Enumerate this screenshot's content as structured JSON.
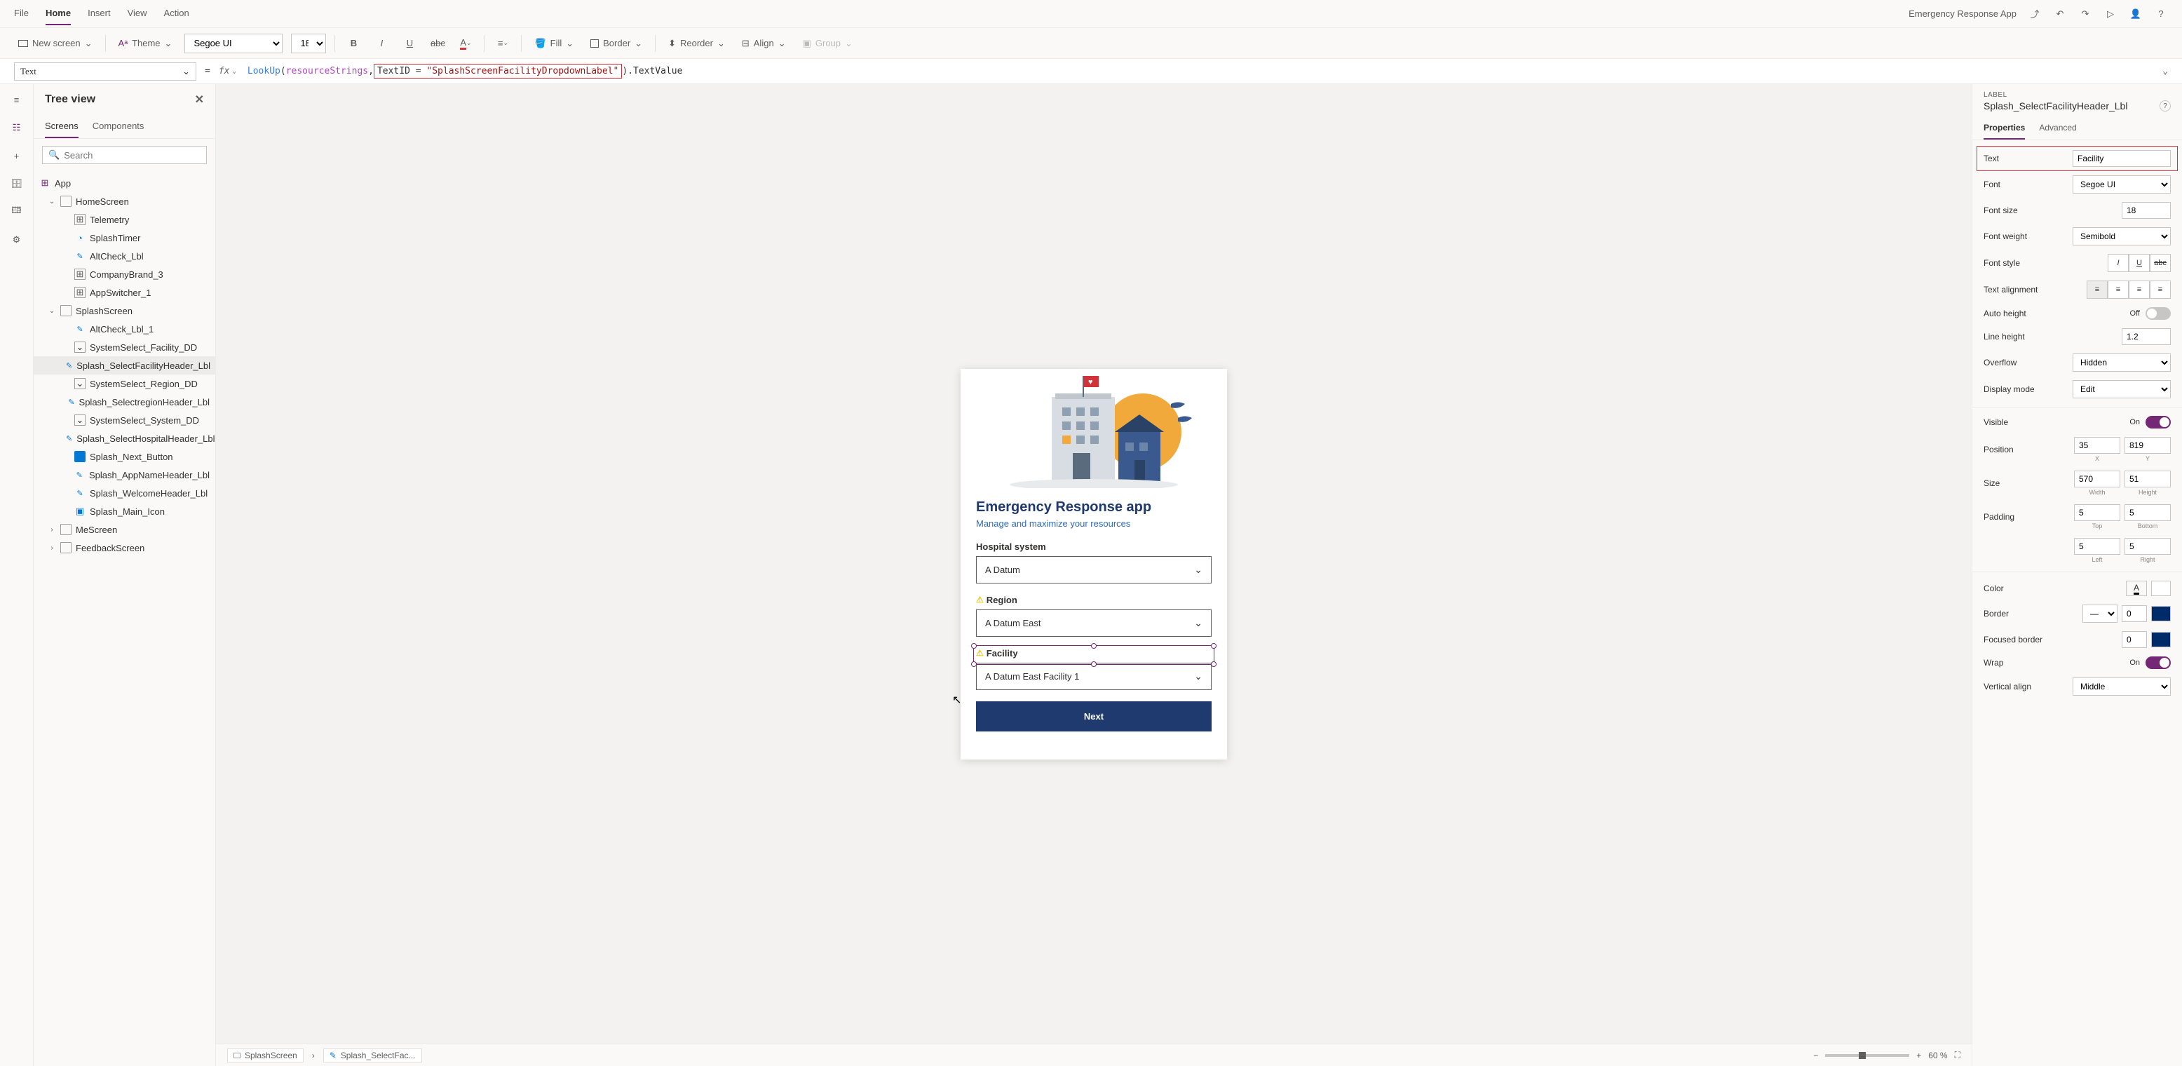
{
  "top": {
    "menus": [
      "File",
      "Home",
      "Insert",
      "View",
      "Action"
    ],
    "active": "Home",
    "appName": "Emergency Response App"
  },
  "ribbon": {
    "newScreen": "New screen",
    "theme": "Theme",
    "font": "Segoe UI",
    "size": "18",
    "fill": "Fill",
    "border": "Border",
    "reorder": "Reorder",
    "align": "Align",
    "group": "Group"
  },
  "formula": {
    "property": "Text",
    "fn": "LookUp",
    "arg1": "resourceStrings",
    "highlighted": "TextID = \"SplashScreenFacilityDropdownLabel\"",
    "suffix": ".TextValue"
  },
  "tree": {
    "title": "Tree view",
    "tabs": [
      "Screens",
      "Components"
    ],
    "activeTab": "Screens",
    "searchPlaceholder": "Search",
    "root": "App",
    "items": [
      {
        "name": "HomeScreen",
        "type": "screen",
        "indent": 1,
        "expanded": true
      },
      {
        "name": "Telemetry",
        "type": "group",
        "indent": 2
      },
      {
        "name": "SplashTimer",
        "type": "timer",
        "indent": 2
      },
      {
        "name": "AltCheck_Lbl",
        "type": "label",
        "indent": 2
      },
      {
        "name": "CompanyBrand_3",
        "type": "group",
        "indent": 2
      },
      {
        "name": "AppSwitcher_1",
        "type": "group",
        "indent": 2
      },
      {
        "name": "SplashScreen",
        "type": "screen",
        "indent": 1,
        "expanded": true
      },
      {
        "name": "AltCheck_Lbl_1",
        "type": "label",
        "indent": 2
      },
      {
        "name": "SystemSelect_Facility_DD",
        "type": "dropdown",
        "indent": 2
      },
      {
        "name": "Splash_SelectFacilityHeader_Lbl",
        "type": "label",
        "indent": 2,
        "selected": true
      },
      {
        "name": "SystemSelect_Region_DD",
        "type": "dropdown",
        "indent": 2
      },
      {
        "name": "Splash_SelectregionHeader_Lbl",
        "type": "label",
        "indent": 2
      },
      {
        "name": "SystemSelect_System_DD",
        "type": "dropdown",
        "indent": 2
      },
      {
        "name": "Splash_SelectHospitalHeader_Lbl",
        "type": "label",
        "indent": 2
      },
      {
        "name": "Splash_Next_Button",
        "type": "button",
        "indent": 2
      },
      {
        "name": "Splash_AppNameHeader_Lbl",
        "type": "label",
        "indent": 2
      },
      {
        "name": "Splash_WelcomeHeader_Lbl",
        "type": "label",
        "indent": 2
      },
      {
        "name": "Splash_Main_Icon",
        "type": "image",
        "indent": 2
      },
      {
        "name": "MeScreen",
        "type": "screen",
        "indent": 1,
        "expanded": false
      },
      {
        "name": "FeedbackScreen",
        "type": "screen",
        "indent": 1,
        "expanded": false
      }
    ]
  },
  "canvas": {
    "appTitle": "Emergency Response app",
    "appSubtitle": "Manage and maximize your resources",
    "fields": {
      "hospital": {
        "label": "Hospital system",
        "value": "A Datum"
      },
      "region": {
        "label": "Region",
        "value": "A Datum East",
        "warn": true
      },
      "facility": {
        "label": "Facility",
        "value": "A Datum East Facility 1",
        "warn": true,
        "selected": true
      }
    },
    "nextLabel": "Next",
    "breadcrumb1": "SplashScreen",
    "breadcrumb2": "Splash_SelectFac...",
    "zoom": "60 %"
  },
  "props": {
    "caption": "LABEL",
    "selName": "Splash_SelectFacilityHeader_Lbl",
    "tabs": [
      "Properties",
      "Advanced"
    ],
    "activeTab": "Properties",
    "text": {
      "label": "Text",
      "value": "Facility"
    },
    "font": {
      "label": "Font",
      "value": "Segoe UI"
    },
    "fontSize": {
      "label": "Font size",
      "value": "18"
    },
    "fontWeight": {
      "label": "Font weight",
      "value": "Semibold"
    },
    "fontStyle": {
      "label": "Font style"
    },
    "textAlign": {
      "label": "Text alignment"
    },
    "autoHeight": {
      "label": "Auto height",
      "value": "Off"
    },
    "lineHeight": {
      "label": "Line height",
      "value": "1.2"
    },
    "overflow": {
      "label": "Overflow",
      "value": "Hidden"
    },
    "displayMode": {
      "label": "Display mode",
      "value": "Edit"
    },
    "visible": {
      "label": "Visible",
      "value": "On"
    },
    "position": {
      "label": "Position",
      "x": "35",
      "y": "819",
      "xl": "X",
      "yl": "Y"
    },
    "size": {
      "label": "Size",
      "w": "570",
      "h": "51",
      "wl": "Width",
      "hl": "Height"
    },
    "padding": {
      "label": "Padding",
      "t": "5",
      "b": "5",
      "l": "5",
      "r": "5",
      "tl": "Top",
      "bl": "Bottom",
      "ll": "Left",
      "rl": "Right"
    },
    "color": {
      "label": "Color"
    },
    "border": {
      "label": "Border",
      "value": "0"
    },
    "focusBorder": {
      "label": "Focused border",
      "value": "0"
    },
    "wrap": {
      "label": "Wrap",
      "value": "On"
    },
    "vertAlign": {
      "label": "Vertical align",
      "value": "Middle"
    }
  }
}
